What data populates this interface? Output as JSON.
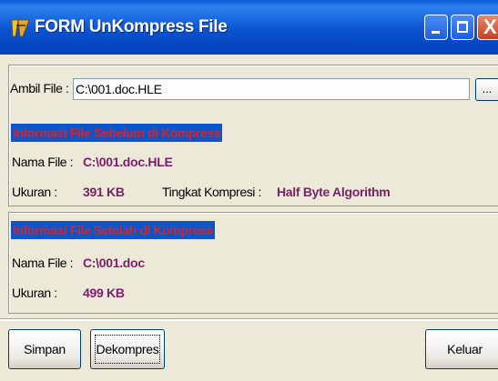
{
  "window": {
    "title": "FORM UnKompress File",
    "controls": [
      "minimize-icon",
      "maximize-icon",
      "close-icon"
    ]
  },
  "input": {
    "label": "Ambil File :",
    "value": "C:\\001.doc.HLE",
    "browse_label": "..."
  },
  "before": {
    "heading": "Informasi File Sebelum di Kompress",
    "name_label": "Nama File :",
    "name_value": "C:\\001.doc.HLE",
    "size_label": "Ukuran :",
    "size_value": "391 KB",
    "level_label": "Tingkat Kompresi :",
    "level_value": "Half Byte Algorithm"
  },
  "after": {
    "heading": "Informasi File Setelah di Kompress",
    "name_label": "Nama File :",
    "name_value": "C:\\001.doc",
    "size_label": "Ukuran :",
    "size_value": "499 KB"
  },
  "buttons": {
    "save": "Simpan",
    "decompress": "Dekompres",
    "exit": "Keluar"
  },
  "colors": {
    "titlebar": "#0a53d0",
    "heading_bg": "#0b55c8",
    "heading_text": "#d7232a",
    "value_text": "#7a1f6b",
    "close_button": "#c6401f"
  }
}
